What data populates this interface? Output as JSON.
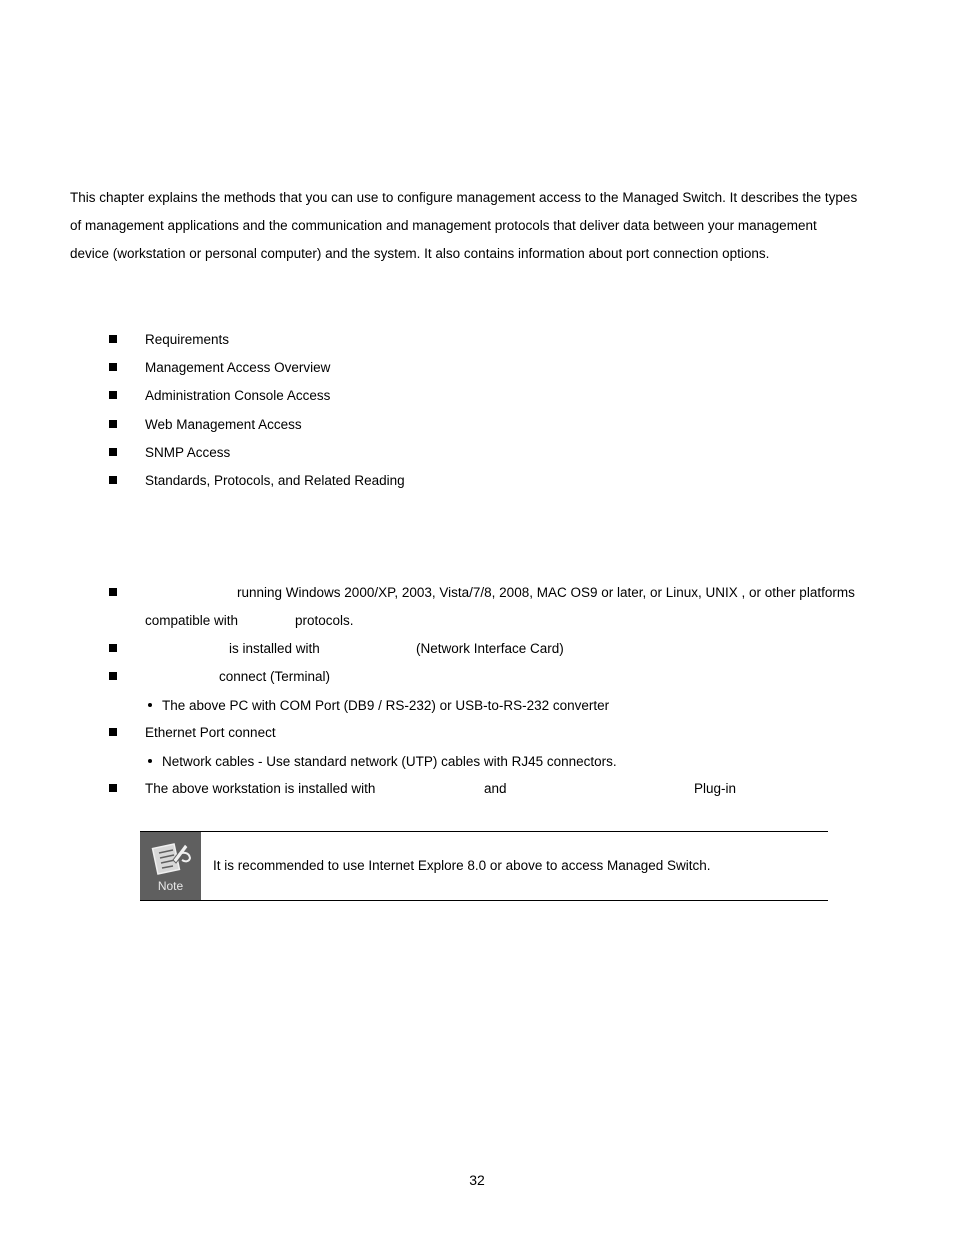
{
  "intro": {
    "lines": [
      "This chapter explains the methods that you can use to configure management access to the Managed Switch. It describes the types",
      "of management applications and the communication and management protocols that deliver data between your management",
      "device (workstation or personal computer) and the system. It also contains information about port connection options."
    ]
  },
  "topics": [
    "Requirements",
    "Management Access Overview",
    "Administration Console Access",
    "Web Management Access",
    "SNMP Access",
    "Standards, Protocols, and Related Reading"
  ],
  "requirements": {
    "item1_line1": "running Windows 2000/XP, 2003, Vista/7/8, 2008, MAC OS9 or later, or Linux, UNIX , or other platforms",
    "item1_line2a": "compatible with",
    "item1_line2b": "protocols.",
    "item2a": "is installed with",
    "item2b": "(Network Interface Card)",
    "item3": "connect (Terminal)",
    "item3_sub": "The above PC with COM Port (DB9 / RS-232) or USB-to-RS-232 converter",
    "item4": "Ethernet Port connect",
    "item4_sub": "Network cables - Use standard network (UTP) cables with RJ45 connectors.",
    "item5a": "The above workstation is installed with",
    "item5b": "and",
    "item5c": "Plug-in"
  },
  "note": {
    "icon": "note-pencil-icon",
    "label": "Note",
    "text": "It is recommended to use Internet Explore 8.0 or above to access Managed Switch."
  },
  "page_number": "32"
}
